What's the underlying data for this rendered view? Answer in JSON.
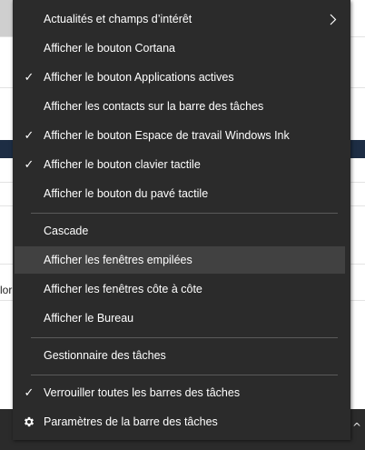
{
  "background": {
    "partial_text": "lor"
  },
  "menu": {
    "items": [
      {
        "label": "Actualités et champs d’intérêt",
        "checked": false,
        "submenu": true,
        "icon": "chevron-right-icon"
      },
      {
        "label": "Afficher le bouton Cortana",
        "checked": false
      },
      {
        "label": "Afficher le bouton Applications actives",
        "checked": true,
        "icon": "check-icon"
      },
      {
        "label": "Afficher les contacts sur la barre des tâches",
        "checked": false
      },
      {
        "label": "Afficher le bouton Espace de travail Windows Ink",
        "checked": true,
        "icon": "check-icon"
      },
      {
        "label": "Afficher le bouton clavier tactile",
        "checked": true,
        "icon": "check-icon"
      },
      {
        "label": "Afficher le bouton du pavé tactile",
        "checked": false
      },
      {
        "label": "Cascade",
        "checked": false
      },
      {
        "label": "Afficher les fenêtres empilées",
        "checked": false,
        "highlighted": true
      },
      {
        "label": "Afficher les fenêtres côte à côte",
        "checked": false
      },
      {
        "label": "Afficher le Bureau",
        "checked": false
      },
      {
        "label": "Gestionnaire des tâches",
        "checked": false
      },
      {
        "label": "Verrouiller toutes les barres des tâches",
        "checked": true,
        "icon": "check-icon"
      },
      {
        "label": "Paramètres de la barre des tâches",
        "checked": false,
        "icon": "gear-icon"
      }
    ],
    "check_glyph": "✓"
  },
  "tray": {
    "chevron_glyph": "^"
  },
  "colors": {
    "menu_bg": "#2b2b2b",
    "highlight": "#414141",
    "separator": "#5a5a5a",
    "text": "#ffffff"
  }
}
